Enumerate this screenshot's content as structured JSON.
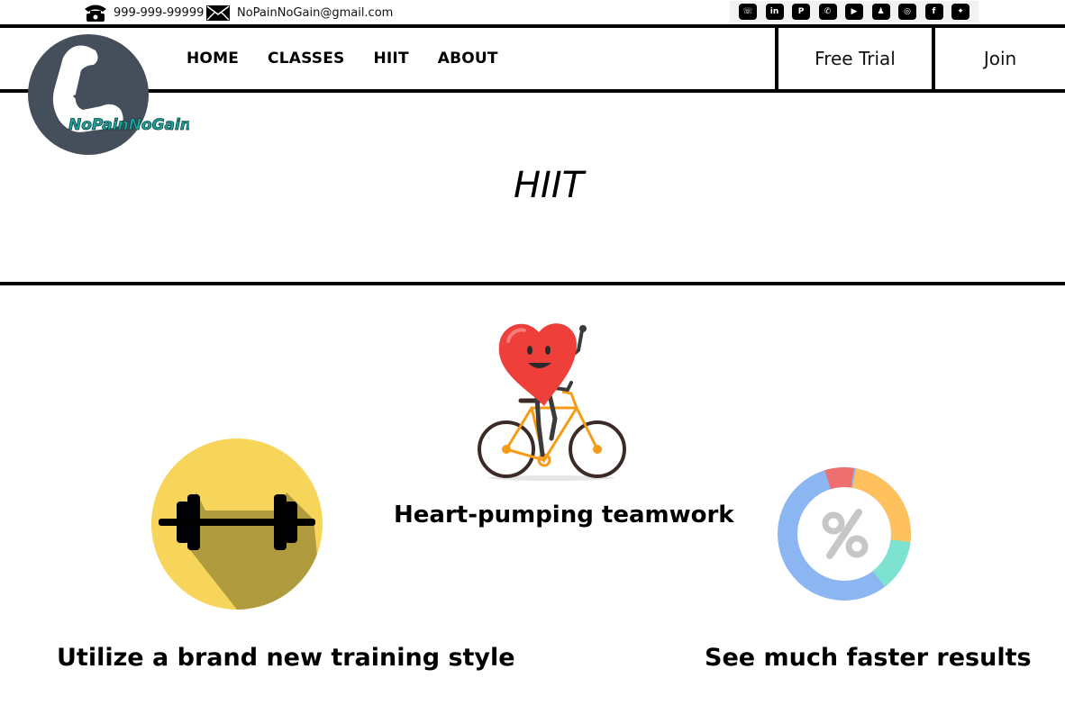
{
  "contact": {
    "phone": "999-999-99999",
    "email": "NoPainNoGain@gmail.com",
    "phone_icon": "phone-icon",
    "email_icon": "envelope-icon"
  },
  "social": [
    {
      "name": "viber-icon",
      "glyph": "☏"
    },
    {
      "name": "linkedin-icon",
      "glyph": "in"
    },
    {
      "name": "pinterest-icon",
      "glyph": "P"
    },
    {
      "name": "whatsapp-icon",
      "glyph": "✆"
    },
    {
      "name": "youtube-icon",
      "glyph": "▶"
    },
    {
      "name": "snapchat-icon",
      "glyph": "♟"
    },
    {
      "name": "instagram-icon",
      "glyph": "◎"
    },
    {
      "name": "facebook-icon",
      "glyph": "f"
    },
    {
      "name": "twitter-icon",
      "glyph": "✦"
    }
  ],
  "brand": {
    "logo_text": "NoPainNoGain",
    "logo_icon": "flexed-arm-icon",
    "colors": {
      "logo_circle": "#454f5b",
      "logo_text": "#1aa6a0"
    }
  },
  "nav": {
    "links": [
      "HOME",
      "CLASSES",
      "HIIT",
      "ABOUT"
    ],
    "free_trial": "Free Trial",
    "join": "Join"
  },
  "page": {
    "title": "HIIT"
  },
  "features": {
    "team": {
      "label": "Heart-pumping teamwork",
      "icon": "heart-cyclist-icon"
    },
    "style": {
      "label": "Utilize a brand new training style",
      "icon": "dumbbell-icon"
    },
    "results": {
      "label": "See much faster results",
      "icon": "percent-donut-icon"
    }
  }
}
